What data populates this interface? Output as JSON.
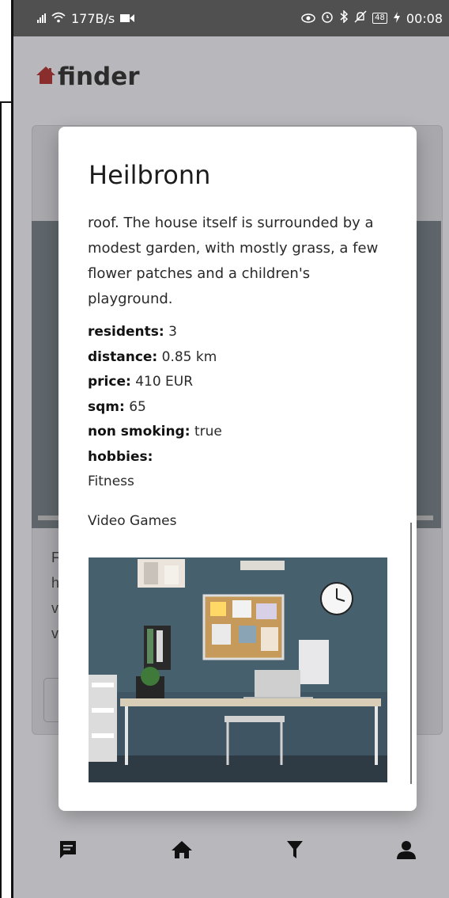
{
  "status_bar": {
    "network_speed": "177B/s",
    "battery_level": "48",
    "time": "00:08",
    "icons": [
      "signal-icon",
      "wifi-icon",
      "video-icon",
      "eye-icon",
      "alarm-icon",
      "bluetooth-icon",
      "mute-icon",
      "battery-icon",
      "charging-icon"
    ]
  },
  "app": {
    "name": "finder",
    "brand_color": "#d23a3a"
  },
  "dialog": {
    "title": "Heilbronn",
    "description": "roof. The house itself is surrounded by a modest garden, with mostly grass, a few flower patches and a children's playground.",
    "details": [
      {
        "label": "residents:",
        "value": "3"
      },
      {
        "label": "distance:",
        "value": "0.85 km"
      },
      {
        "label": "price:",
        "value": "410 EUR"
      },
      {
        "label": "sqm:",
        "value": "65"
      },
      {
        "label": "non smoking:",
        "value": "true"
      }
    ],
    "hobbies_label": "hobbies:",
    "hobbies": [
      "Fitness",
      "Video Games"
    ]
  },
  "background_card": {
    "text_fragments": [
      "F",
      "h",
      "v",
      "v"
    ]
  },
  "bottom_nav": {
    "items": [
      "chat-icon",
      "home-icon",
      "filter-icon",
      "profile-icon"
    ]
  }
}
